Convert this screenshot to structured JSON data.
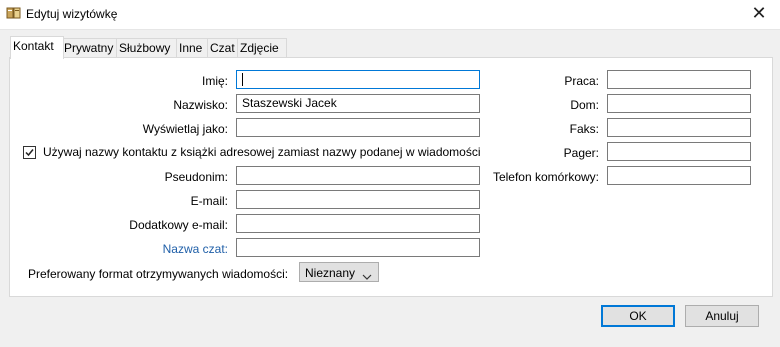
{
  "window": {
    "title": "Edytuj wizytówkę"
  },
  "tabs": [
    {
      "label": "Kontakt"
    },
    {
      "label": "Prywatny"
    },
    {
      "label": "Służbowy"
    },
    {
      "label": "Inne"
    },
    {
      "label": "Czat"
    },
    {
      "label": "Zdjęcie"
    }
  ],
  "form": {
    "first_name": {
      "label": "Imię:",
      "value": ""
    },
    "last_name": {
      "label": "Nazwisko:",
      "value": "Staszewski  Jacek"
    },
    "display_as": {
      "label": "Wyświetlaj jako:",
      "value": ""
    },
    "use_address_book_name": {
      "label": "Używaj nazwy kontaktu z książki adresowej zamiast nazwy podanej w wiadomości",
      "checked": true
    },
    "nickname": {
      "label": "Pseudonim:",
      "value": ""
    },
    "email": {
      "label": "E-mail:",
      "value": ""
    },
    "additional_email": {
      "label": "Dodatkowy e-mail:",
      "value": ""
    },
    "chat_name": {
      "label": "Nazwa czat:",
      "value": ""
    },
    "preferred_format": {
      "label": "Preferowany format otrzymywanych wiadomości:",
      "value": "Nieznany"
    },
    "work": {
      "label": "Praca:",
      "value": ""
    },
    "home": {
      "label": "Dom:",
      "value": ""
    },
    "fax": {
      "label": "Faks:",
      "value": ""
    },
    "pager": {
      "label": "Pager:",
      "value": ""
    },
    "mobile": {
      "label": "Telefon komórkowy:",
      "value": ""
    }
  },
  "buttons": {
    "ok": "OK",
    "cancel": "Anuluj"
  },
  "colors": {
    "accent": "#0078d7",
    "link": "#1f5fa8"
  }
}
